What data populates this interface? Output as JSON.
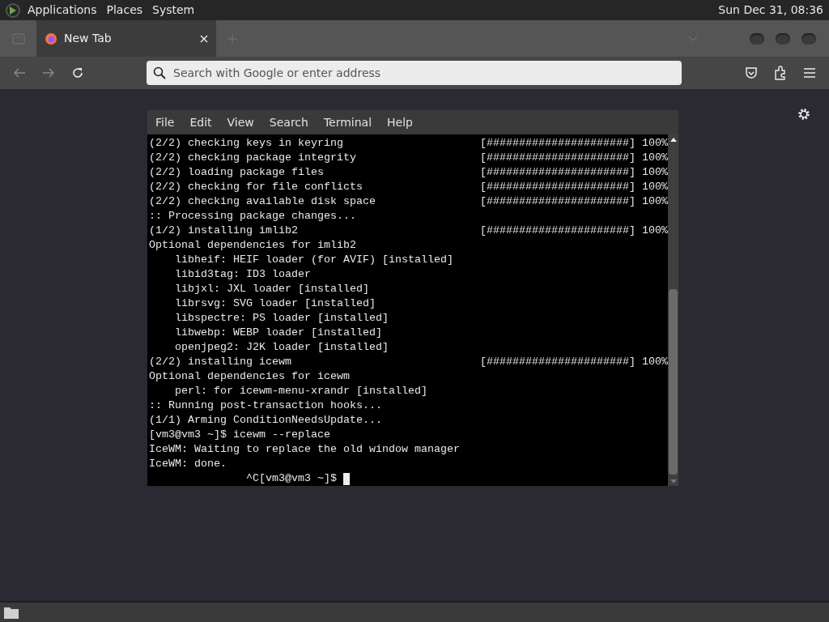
{
  "top_panel": {
    "menus": [
      "Applications",
      "Places",
      "System"
    ],
    "clock": "Sun Dec 31, 08:36"
  },
  "browser": {
    "tabs": [
      {
        "label": "New Tab",
        "selected": true
      }
    ],
    "address_bar": {
      "placeholder": "Search with Google or enter address"
    }
  },
  "terminal": {
    "menu": [
      "File",
      "Edit",
      "View",
      "Search",
      "Terminal",
      "Help"
    ],
    "lines": [
      {
        "text": "(2/2) checking keys in keyring",
        "progress": "[######################] 100%"
      },
      {
        "text": "(2/2) checking package integrity",
        "progress": "[######################] 100%"
      },
      {
        "text": "(2/2) loading package files",
        "progress": "[######################] 100%"
      },
      {
        "text": "(2/2) checking for file conflicts",
        "progress": "[######################] 100%"
      },
      {
        "text": "(2/2) checking available disk space",
        "progress": "[######################] 100%"
      },
      {
        "text": ":: Processing package changes..."
      },
      {
        "text": "(1/2) installing imlib2",
        "progress": "[######################] 100%"
      },
      {
        "text": "Optional dependencies for imlib2"
      },
      {
        "text": "    libheif: HEIF loader (for AVIF) [installed]"
      },
      {
        "text": "    libid3tag: ID3 loader"
      },
      {
        "text": "    libjxl: JXL loader [installed]"
      },
      {
        "text": "    librsvg: SVG loader [installed]"
      },
      {
        "text": "    libspectre: PS loader [installed]"
      },
      {
        "text": "    libwebp: WEBP loader [installed]"
      },
      {
        "text": "    openjpeg2: J2K loader [installed]"
      },
      {
        "text": "(2/2) installing icewm",
        "progress": "[######################] 100%"
      },
      {
        "text": "Optional dependencies for icewm"
      },
      {
        "text": "    perl: for icewm-menu-xrandr [installed]"
      },
      {
        "text": ":: Running post-transaction hooks..."
      },
      {
        "text": "(1/1) Arming ConditionNeedsUpdate..."
      },
      {
        "text": "[vm3@vm3 ~]$ icewm --replace"
      },
      {
        "text": "IceWM: Waiting to replace the old window manager"
      },
      {
        "text": "IceWM: done."
      },
      {
        "text": "               ^C[vm3@vm3 ~]$ ",
        "cursor": true
      }
    ]
  }
}
